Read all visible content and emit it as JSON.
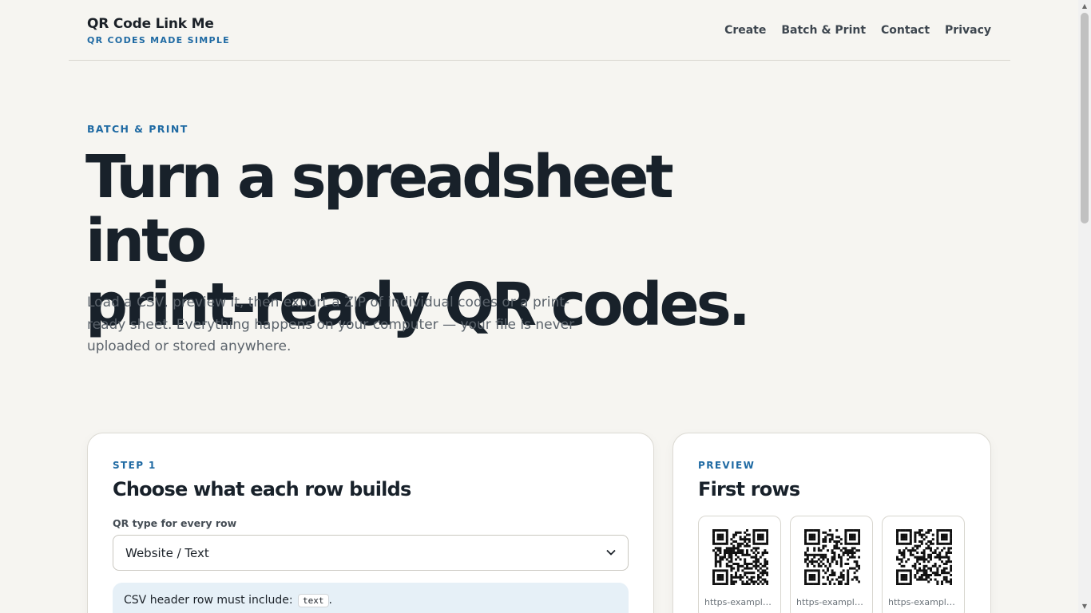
{
  "header": {
    "brand_title": "QR Code Link Me",
    "brand_tagline": "QR CODES MADE SIMPLE",
    "nav": [
      "Create",
      "Batch & Print",
      "Contact",
      "Privacy"
    ]
  },
  "hero": {
    "eyebrow": "BATCH & PRINT",
    "title_line1": "Turn a spreadsheet into",
    "title_line2": "print-ready QR codes.",
    "description": "Load a CSV, preview it, then export a ZIP of individual codes or a print-ready sheet. Everything happens on your computer — your file is never uploaded or stored anywhere."
  },
  "step1": {
    "label": "STEP 1",
    "heading": "Choose what each row builds",
    "field_label": "QR type for every row",
    "select_value": "Website / Text",
    "hint_prefix": "CSV header row must include:",
    "hint_code": "text",
    "hint_suffix": "."
  },
  "preview": {
    "label": "PREVIEW",
    "heading": "First rows",
    "tiles": [
      {
        "label": "https-example-c..."
      },
      {
        "label": "https-example-c..."
      },
      {
        "label": "https-example-c..."
      }
    ]
  },
  "colors": {
    "accent": "#1f6aa3",
    "background": "#f6f5f1",
    "hint_background": "#e6f0f7"
  }
}
